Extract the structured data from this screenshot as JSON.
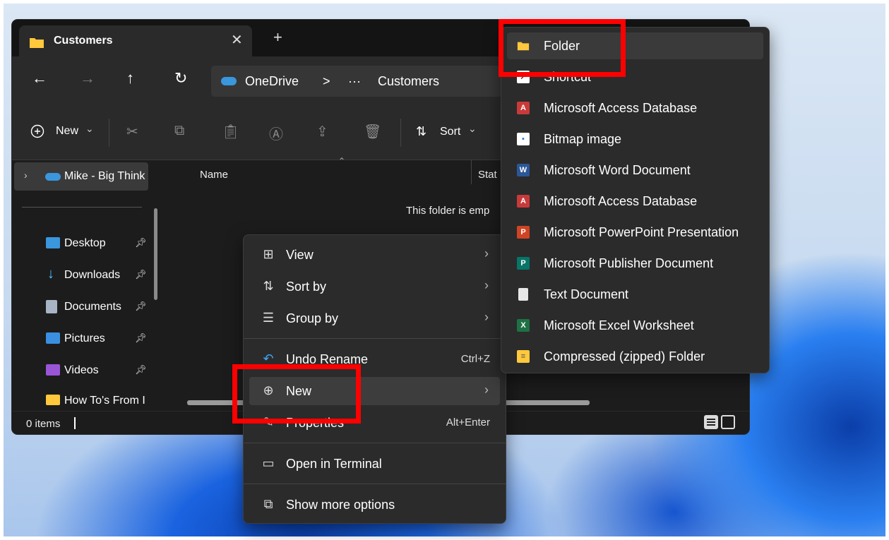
{
  "window": {
    "tab_title": "Customers",
    "tab_close": "✕",
    "new_tab": "+"
  },
  "nav": {
    "back": "←",
    "forward": "→",
    "up": "↑",
    "refresh": "↻",
    "breadcrumb": [
      "OneDrive",
      ">",
      "···",
      "Customers"
    ]
  },
  "toolbar": {
    "new_label": "New",
    "new_chevron": "⌄",
    "sort_label": "Sort",
    "sort_chevron": "⌄"
  },
  "sidebar": {
    "root_label": "Mike - Big Think",
    "items": [
      {
        "label": "Desktop",
        "icon": "desktop-icon",
        "color": "#3a96dd"
      },
      {
        "label": "Downloads",
        "icon": "download-icon",
        "color": "#4cc2ff"
      },
      {
        "label": "Documents",
        "icon": "document-icon",
        "color": "#a7b4c6"
      },
      {
        "label": "Pictures",
        "icon": "pictures-icon",
        "color": "#3a8fe0"
      },
      {
        "label": "Videos",
        "icon": "videos-icon",
        "color": "#9a55d6"
      },
      {
        "label": "How To's From I",
        "icon": "folder-icon",
        "color": "#ffc83d"
      }
    ]
  },
  "content": {
    "col_name": "Name",
    "col_status": "Stat",
    "empty_message": "This folder is emp"
  },
  "status": {
    "items_count": "0 items"
  },
  "context_menu": {
    "items": [
      {
        "icon": "view-icon",
        "glyph": "⊞",
        "label": "View",
        "submenu": "›"
      },
      {
        "icon": "sort-icon",
        "glyph": "⇅",
        "label": "Sort by",
        "submenu": "›"
      },
      {
        "icon": "group-icon",
        "glyph": "☰",
        "label": "Group by",
        "submenu": "›"
      },
      {
        "icon": "undo-icon",
        "glyph": "↶",
        "label": "Undo Rename",
        "shortcut": "Ctrl+Z"
      },
      {
        "icon": "new-icon",
        "glyph": "⊕",
        "label": "New",
        "submenu": "›"
      },
      {
        "icon": "properties-icon",
        "glyph": "✎",
        "label": "Properties",
        "shortcut": "Alt+Enter"
      },
      {
        "icon": "terminal-icon",
        "glyph": "▭",
        "label": "Open in Terminal"
      },
      {
        "icon": "more-options-icon",
        "glyph": "⧉",
        "label": "Show more options"
      }
    ]
  },
  "new_submenu": {
    "items": [
      {
        "label": "Folder",
        "icon": "folder-icon",
        "color": "#ffc83d",
        "glyph": ""
      },
      {
        "label": "Shortcut",
        "icon": "shortcut-icon",
        "color": "#ffffff",
        "glyph": "↗"
      },
      {
        "label": "Microsoft Access Database",
        "icon": "access-icon",
        "color": "#c83a3a",
        "glyph": "A"
      },
      {
        "label": "Bitmap image",
        "icon": "bitmap-icon",
        "color": "#2b7cd3",
        "glyph": "▪"
      },
      {
        "label": "Microsoft Word Document",
        "icon": "word-icon",
        "color": "#2b5797",
        "glyph": "W"
      },
      {
        "label": "Microsoft Access Database",
        "icon": "access-icon",
        "color": "#c83a3a",
        "glyph": "A"
      },
      {
        "label": "Microsoft PowerPoint Presentation",
        "icon": "powerpoint-icon",
        "color": "#d04423",
        "glyph": "P"
      },
      {
        "label": "Microsoft Publisher Document",
        "icon": "publisher-icon",
        "color": "#077568",
        "glyph": "P"
      },
      {
        "label": "Text Document",
        "icon": "text-document-icon",
        "color": "#e8e8e8",
        "glyph": ""
      },
      {
        "label": "Microsoft Excel Worksheet",
        "icon": "excel-icon",
        "color": "#1e7145",
        "glyph": "X"
      },
      {
        "label": "Compressed (zipped) Folder",
        "icon": "zip-folder-icon",
        "color": "#ffc83d",
        "glyph": "≡"
      }
    ]
  }
}
